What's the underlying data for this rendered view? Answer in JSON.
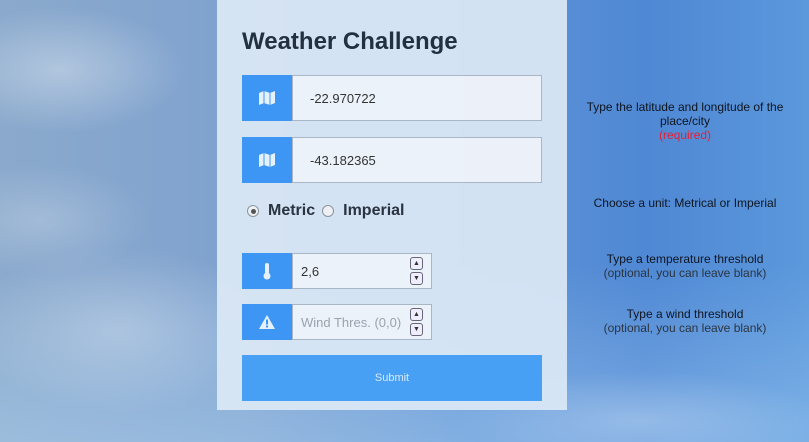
{
  "form": {
    "title": "Weather Challenge",
    "latitude_value": "-22.970722",
    "longitude_value": "-43.182365",
    "unit_options": [
      "Metric",
      "Imperial"
    ],
    "selected_unit": "Metric",
    "temperature_value": "2,6",
    "wind_placeholder": "Wind Thres. (0,0)",
    "submit_label": "Submit"
  },
  "help": {
    "location_line": "Type the latitude and longitude of the place/city",
    "location_required": "(required)",
    "unit_line": "Choose a unit: Metrical or Imperial",
    "temperature_line": "Type a temperature threshold",
    "temperature_optional": "(optional, you can leave blank)",
    "wind_line": "Type a wind threshold",
    "wind_optional": "(optional, you can leave blank)"
  },
  "icons": {
    "latitude": "map-icon",
    "longitude": "map-icon",
    "temperature": "thermometer-icon",
    "wind": "warning-icon"
  },
  "colors": {
    "accent": "#3d96f3",
    "required": "#e0213a"
  }
}
